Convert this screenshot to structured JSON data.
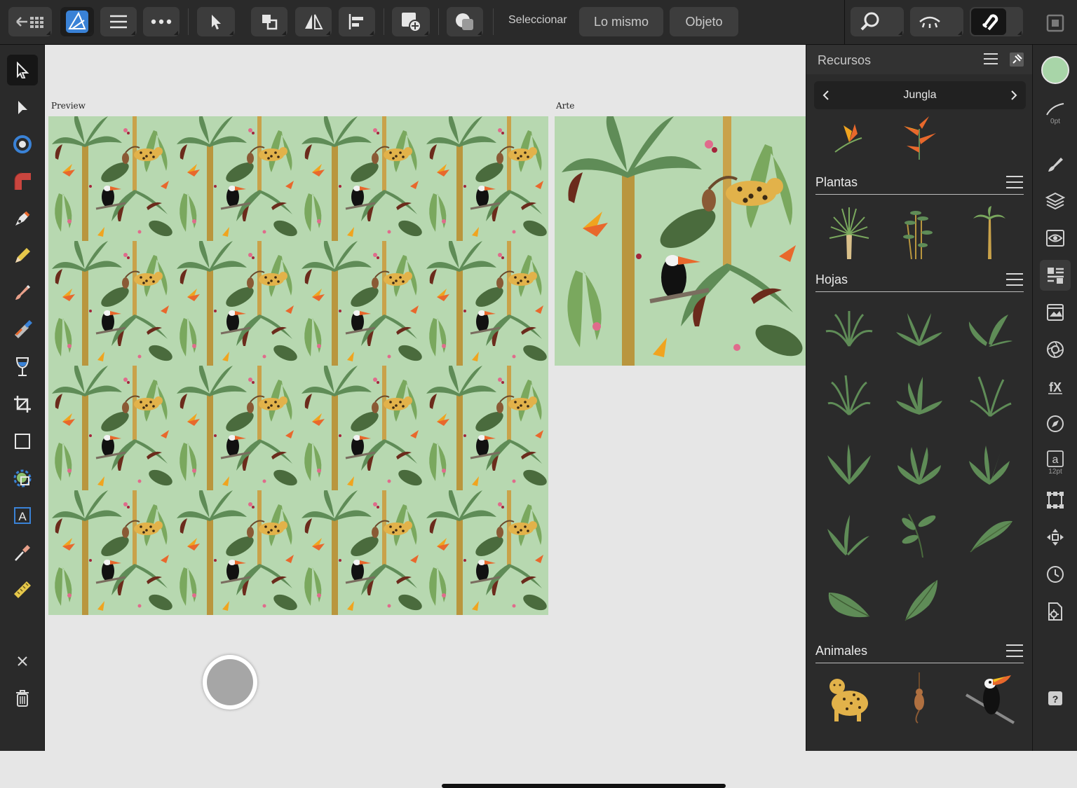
{
  "toolbar": {
    "back_icon": "back-grid-icon",
    "select_label": "Seleccionar",
    "same_button": "Lo mismo",
    "object_button": "Objeto"
  },
  "canvas": {
    "preview_label": "Preview",
    "art_label": "Arte",
    "background_color": "#b7d8b0"
  },
  "panel": {
    "title": "Recursos",
    "category": "Jungla",
    "sections": [
      {
        "title": "Plantas"
      },
      {
        "title": "Hojas"
      },
      {
        "title": "Animales"
      }
    ]
  },
  "right": {
    "stroke_width": "0pt",
    "text_size": "12pt",
    "fill_color": "#a8d5a8"
  },
  "colors": {
    "accent": "#3a82d6",
    "leaf": "#5f8c57",
    "orange": "#e8682c"
  }
}
